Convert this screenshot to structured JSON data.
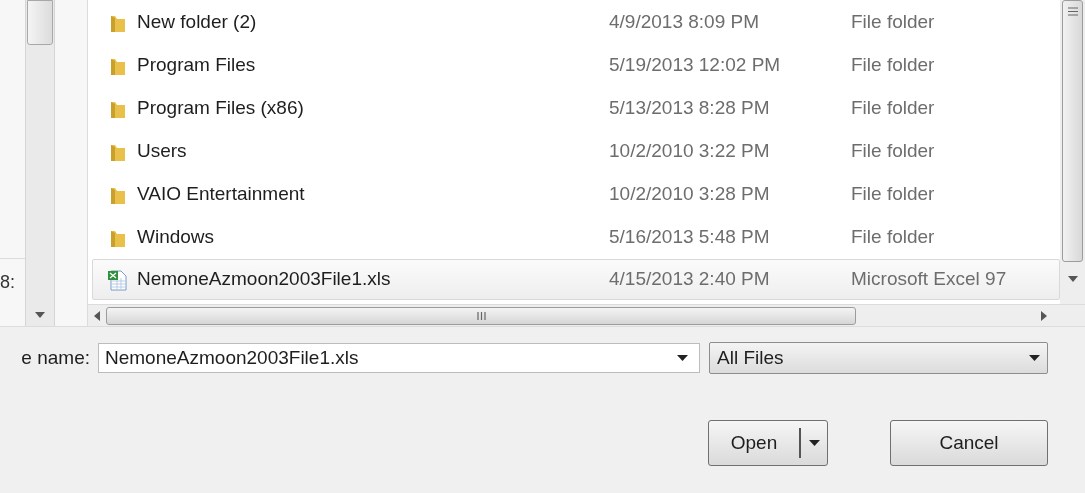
{
  "nav_pane": {
    "cut_text": "8:"
  },
  "files": [
    {
      "kind": "folder",
      "name": "New folder (2)",
      "date": "4/9/2013 8:09 PM",
      "type": "File folder",
      "selected": false
    },
    {
      "kind": "folder",
      "name": "Program Files",
      "date": "5/19/2013 12:02 PM",
      "type": "File folder",
      "selected": false
    },
    {
      "kind": "folder",
      "name": "Program Files (x86)",
      "date": "5/13/2013 8:28 PM",
      "type": "File folder",
      "selected": false
    },
    {
      "kind": "folder",
      "name": "Users",
      "date": "10/2/2010 3:22 PM",
      "type": "File folder",
      "selected": false
    },
    {
      "kind": "folder",
      "name": "VAIO Entertainment",
      "date": "10/2/2010 3:28 PM",
      "type": "File folder",
      "selected": false
    },
    {
      "kind": "folder",
      "name": "Windows",
      "date": "5/16/2013 5:48 PM",
      "type": "File folder",
      "selected": false
    },
    {
      "kind": "excel",
      "name": "NemoneAzmoon2003File1.xls",
      "date": "4/15/2013 2:40 PM",
      "type": "Microsoft Excel 97",
      "selected": true
    }
  ],
  "file_name": {
    "label": "e name:",
    "value": "NemoneAzmoon2003File1.xls"
  },
  "file_type": {
    "value": "All Files"
  },
  "buttons": [
    "Open",
    "Cancel"
  ]
}
